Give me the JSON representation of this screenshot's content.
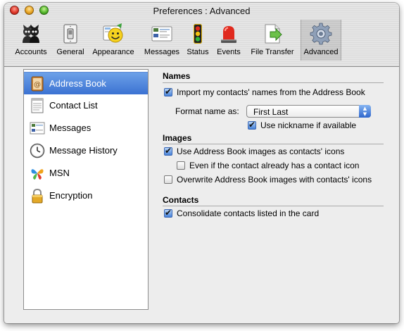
{
  "window": {
    "title": "Preferences : Advanced"
  },
  "toolbar": {
    "items": [
      {
        "label": "Accounts",
        "icon": "accounts-icon"
      },
      {
        "label": "General",
        "icon": "general-switch-icon"
      },
      {
        "label": "Appearance",
        "icon": "appearance-smiley-icon"
      },
      {
        "label": "Messages",
        "icon": "messages-icon"
      },
      {
        "label": "Status",
        "icon": "status-traffic-light-icon"
      },
      {
        "label": "Events",
        "icon": "events-siren-icon"
      },
      {
        "label": "File Transfer",
        "icon": "file-transfer-icon"
      },
      {
        "label": "Advanced",
        "icon": "advanced-gear-icon"
      }
    ],
    "selected": "Advanced"
  },
  "sidebar": {
    "items": [
      {
        "label": "Address Book",
        "icon": "address-book-icon"
      },
      {
        "label": "Contact List",
        "icon": "contact-list-icon"
      },
      {
        "label": "Messages",
        "icon": "messages-icon"
      },
      {
        "label": "Message History",
        "icon": "clock-icon"
      },
      {
        "label": "MSN",
        "icon": "msn-butterfly-icon"
      },
      {
        "label": "Encryption",
        "icon": "padlock-icon"
      }
    ],
    "selected": "Address Book"
  },
  "names": {
    "title": "Names",
    "import_label": "Import my contacts' names from the Address Book",
    "import_checked": true,
    "format_label": "Format name as:",
    "format_value": "First Last",
    "nickname_label": "Use nickname if available",
    "nickname_checked": true
  },
  "images": {
    "title": "Images",
    "use_images_label": "Use Address Book images as contacts' icons",
    "use_images_checked": true,
    "even_if_label": "Even if the contact already has a contact icon",
    "even_if_checked": false,
    "overwrite_label": "Overwrite Address Book images with contacts' icons",
    "overwrite_checked": false
  },
  "contacts": {
    "title": "Contacts",
    "consolidate_label": "Consolidate contacts listed in the card",
    "consolidate_checked": true
  },
  "colors": {
    "selection_blue": "#3b72d2",
    "window_gray": "#ededed"
  }
}
